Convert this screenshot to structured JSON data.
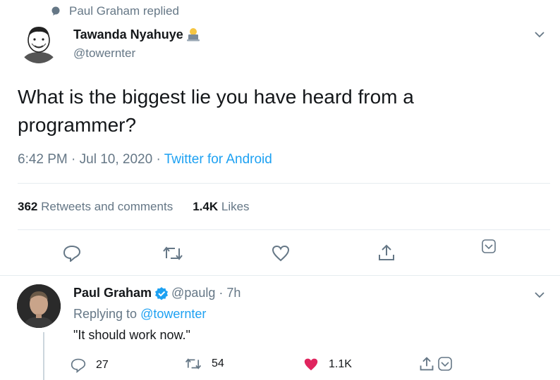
{
  "context": {
    "text": "Paul Graham replied"
  },
  "tweet": {
    "author_name": "Tawanda Nyahuye",
    "author_handle": "@towernter",
    "text": "What is the biggest lie you have heard from a programmer?",
    "time": "6:42 PM · Jul 10, 2020 · ",
    "source": "Twitter for Android",
    "retweets_count": "362",
    "retweets_label": "Retweets and comments",
    "likes_count": "1.4K",
    "likes_label": "Likes"
  },
  "reply": {
    "author_name": "Paul Graham",
    "author_handle": "@paulg",
    "age": "· 7h",
    "replying_prefix": "Replying to ",
    "replying_to": "@towernter",
    "text": "\"It should work now.\"",
    "reply_count": "27",
    "retweet_count": "54",
    "like_count": "1.1K"
  },
  "colors": {
    "accent": "#1da1f2",
    "like": "#e0245e",
    "muted": "#657786",
    "verified": "#1da1f2"
  },
  "icons": [
    "speech-bubble-icon",
    "chevron-down-icon",
    "reply-icon",
    "retweet-icon",
    "heart-icon",
    "share-icon",
    "bookmark-icon",
    "verified-badge-icon",
    "laptop-emoji-icon"
  ]
}
